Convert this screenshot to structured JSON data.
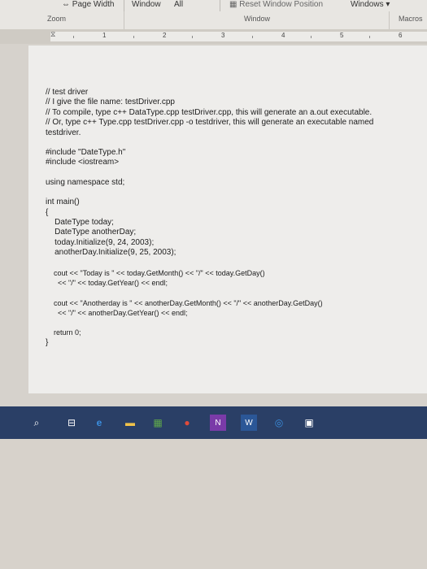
{
  "ribbon": {
    "page_width": "Page Width",
    "window_tab": "Window",
    "all": "All",
    "reset_window_position": "Reset Window Position",
    "windows_dropdown": "Windows",
    "zoom_group": "Zoom",
    "window_group": "Window",
    "macros_group": "Macros"
  },
  "ruler": {
    "marks": [
      "1",
      "2",
      "3",
      "4",
      "5",
      "6"
    ]
  },
  "document": {
    "lines": [
      "// test driver",
      "// I give the file name: testDriver.cpp",
      "// To compile, type c++ DataType.cpp testDriver.cpp, this will generate an a.out executable.",
      "// Or, type c++ Type.cpp testDriver.cpp -o testdriver, this will generate an executable named",
      "testdriver.",
      "",
      "#include \"DateType.h\"",
      "#include <iostream>",
      "",
      "using namespace std;",
      "",
      "int main()",
      "{",
      "    DateType today;",
      "    DateType anotherDay;",
      "    today.Initialize(9, 24, 2003);",
      "    anotherDay.Initialize(9, 25, 2003);",
      "",
      "    cout << \"Today is \" << today.GetMonth() << \"/\" << today.GetDay()",
      "      << \"/\" << today.GetYear() << endl;",
      "",
      "    cout << \"Anotherday is \" << anotherDay.GetMonth() << \"/\" << anotherDay.GetDay()",
      "      << \"/\" << anotherDay.GetYear() << endl;",
      "",
      "    return 0;",
      "}"
    ]
  },
  "taskbar": {
    "icons": [
      "file-explorer-icon",
      "edge-icon",
      "store-icon",
      "calculator-icon",
      "chrome-icon",
      "onenote-icon",
      "word-icon",
      "media-icon",
      "app-icon"
    ],
    "colors": {
      "taskbar": "#2a3f66",
      "edge": "#3b8fe0",
      "chrome": "#e04b3a",
      "onenote": "#7a3ba8",
      "word": "#2b5797",
      "green": "#5fa84b"
    }
  }
}
